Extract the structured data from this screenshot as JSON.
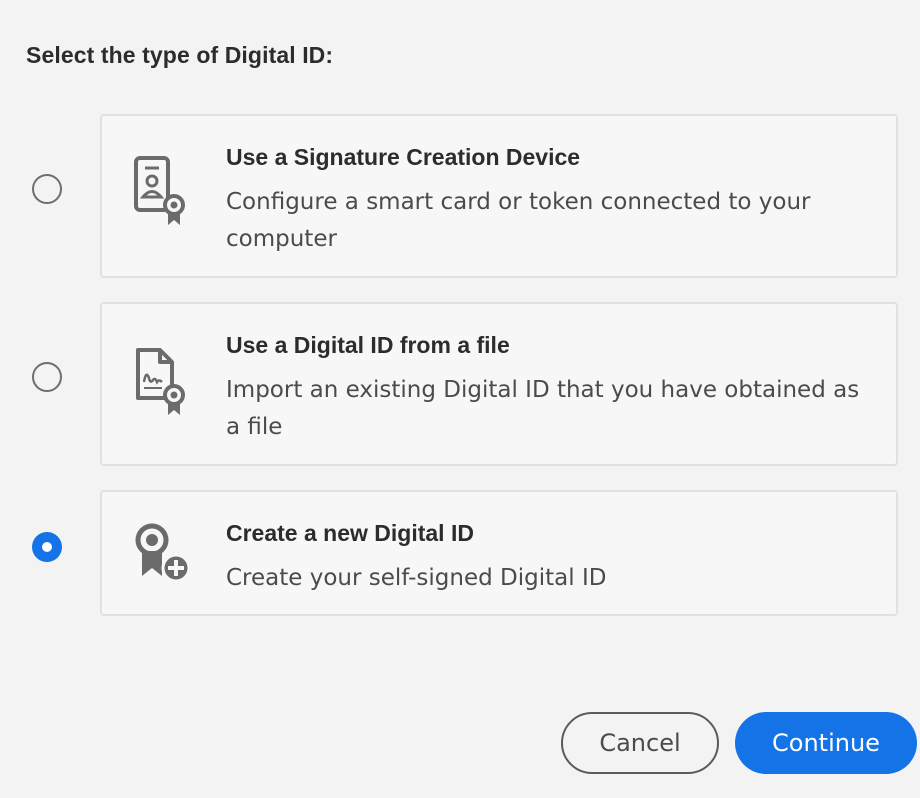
{
  "dialog": {
    "heading": "Select the type of Digital ID:"
  },
  "options": [
    {
      "title": "Use a Signature Creation Device",
      "description": "Configure a smart card or token connected to your computer",
      "icon": "signature-device-icon",
      "selected": false
    },
    {
      "title": "Use a Digital ID from a file",
      "description": "Import an existing Digital ID that you have obtained as a file",
      "icon": "digital-id-file-icon",
      "selected": false
    },
    {
      "title": "Create a new Digital ID",
      "description": "Create your self-signed Digital ID",
      "icon": "new-digital-id-icon",
      "selected": true
    }
  ],
  "buttons": {
    "cancel": "Cancel",
    "continue": "Continue"
  },
  "colors": {
    "accent": "#1473e6",
    "icon": "#6b6b6b"
  }
}
